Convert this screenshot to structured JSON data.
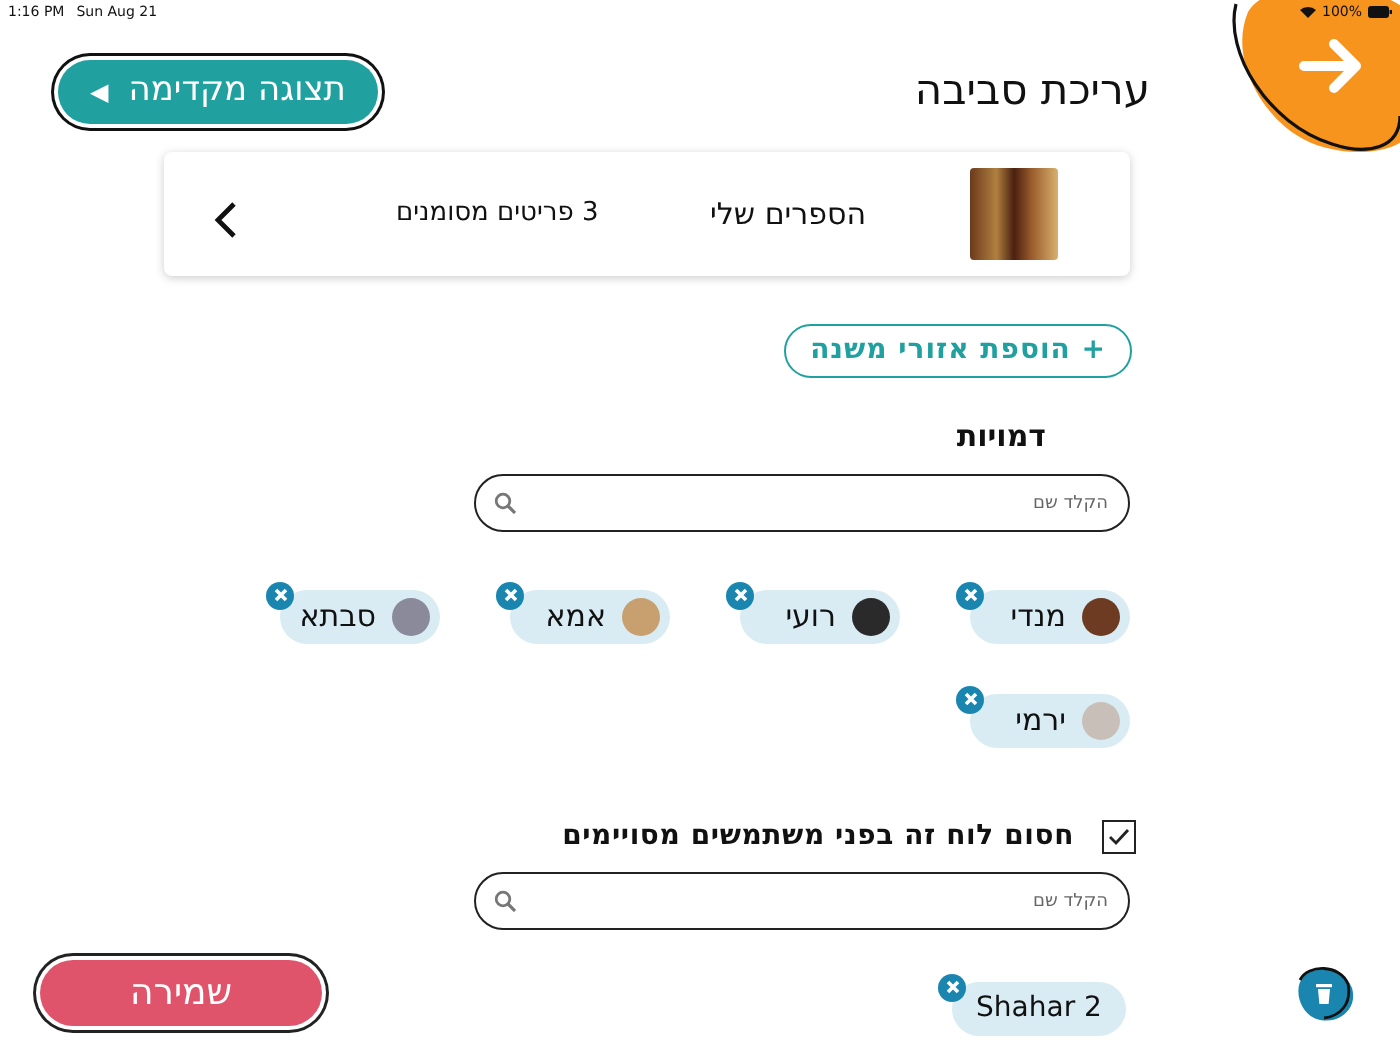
{
  "status_bar": {
    "time": "1:16 PM",
    "date": "Sun Aug 21",
    "battery": "100%"
  },
  "header": {
    "title": "עריכת סביבה",
    "preview_button": {
      "label": "תצוגה מקדימה",
      "icon": "◀"
    }
  },
  "collection": {
    "title": "הספרים שלי",
    "summary": "3 פריטים מסומנים"
  },
  "add_button": "+ הוספת אזורי משנה",
  "characters": {
    "heading": "דמויות",
    "search": {
      "placeholder": "הקלד שם"
    },
    "items": [
      {
        "name": "מנדי"
      },
      {
        "name": "רועי"
      },
      {
        "name": "אמא"
      },
      {
        "name": "סבתא"
      },
      {
        "name": "ירמי"
      }
    ]
  },
  "restrict": {
    "label": "חסום לוח זה בפני משתמשים מסויימים",
    "checked": true,
    "search": {
      "placeholder": "הקלד שם"
    },
    "users": [
      {
        "name": "Shahar 2"
      }
    ]
  },
  "save_button": "שמירה"
}
